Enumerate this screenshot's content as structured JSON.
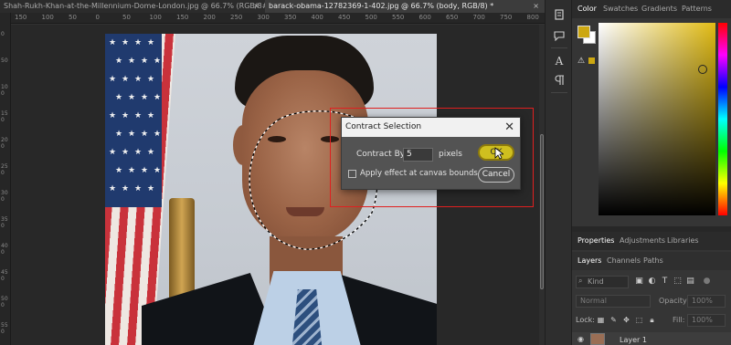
{
  "document_tabs": [
    {
      "title": "Shah-Rukh-Khan-at-the-Millennium-Dome-London.jpg @ 66.7% (RGB/8#) *",
      "close": "×"
    },
    {
      "title": "barack-obama-12782369-1-402.jpg @ 66.7% (body, RGB/8) *",
      "close": "×"
    }
  ],
  "ruler_top": [
    "150",
    "100",
    "50",
    "0",
    "50",
    "100",
    "150",
    "200",
    "250",
    "300",
    "350",
    "400",
    "450",
    "500",
    "550",
    "600",
    "650",
    "700",
    "750",
    "800"
  ],
  "ruler_left": [
    "0",
    "50",
    "100",
    "150",
    "200",
    "250",
    "300",
    "350",
    "400",
    "450",
    "500",
    "550",
    "600"
  ],
  "dialog": {
    "title": "Contract Selection",
    "close": "✕",
    "contract_by_label": "Contract By:",
    "contract_by_value": "5",
    "unit": "pixels",
    "apply_effect_label": "Apply effect at canvas bounds",
    "apply_effect_checked": false,
    "ok_label": "OK",
    "cancel_label": "Cancel"
  },
  "color_panel": {
    "tabs": [
      "Color",
      "Swatches",
      "Gradients",
      "Patterns"
    ],
    "active_tab": "Color",
    "foreground": "#cca711",
    "background": "#ffffff",
    "picker_hue": "#e1bb14"
  },
  "properties_panel": {
    "tabs": [
      "Properties",
      "Adjustments",
      "Libraries"
    ],
    "active_tab": "Properties"
  },
  "layers_panel": {
    "tabs": [
      "Layers",
      "Channels",
      "Paths"
    ],
    "active_tab": "Layers",
    "kind_label": "Kind",
    "blend_mode": "Normal",
    "opacity_label": "Opacity:",
    "opacity_value": "100%",
    "lock_label": "Lock:",
    "fill_label": "Fill:",
    "fill_value": "100%",
    "layer_name": "Layer 1"
  },
  "toolstrip": [
    "history-icon",
    "comments-icon",
    "comments-icon",
    "character-icon",
    "paragraph-icon",
    "styles-icon"
  ],
  "colors": {
    "highlight": "#e02020",
    "ok_button": "#cfbf1f",
    "app_bg": "#323232"
  }
}
